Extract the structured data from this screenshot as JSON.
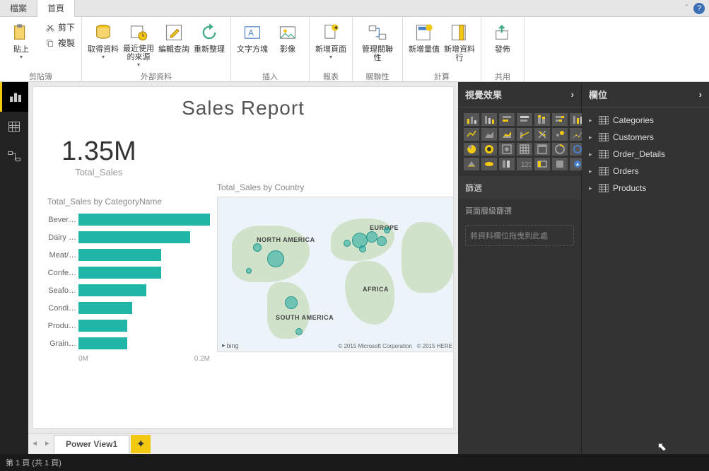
{
  "tabs": {
    "file": "檔案",
    "home": "首頁"
  },
  "ribbon": {
    "clipboard": {
      "paste": "貼上",
      "cut": "剪下",
      "copy": "複製",
      "group": "剪貼簿"
    },
    "external": {
      "getdata": "取得資料",
      "recent": "最近使用的來源",
      "edit": "編輯查詢",
      "refresh": "重新整理",
      "group": "外部資料"
    },
    "insert": {
      "textbox": "文字方塊",
      "image": "影像",
      "group": "插入"
    },
    "report": {
      "newpage": "新增頁面",
      "group": "報表"
    },
    "relation": {
      "manage": "管理關聯性",
      "group": "關聯性"
    },
    "calc": {
      "newmeasure": "新增量值",
      "newtable": "新增資料行",
      "group": "計算"
    },
    "share": {
      "publish": "發佈",
      "group": "共用"
    }
  },
  "report": {
    "title": "Sales Report",
    "kpi_value": "1.35M",
    "kpi_label": "Total_Sales",
    "bar_title": "Total_Sales by CategoryName",
    "map_title": "Total_Sales by Country",
    "map_labels": {
      "na": "NORTH AMERICA",
      "sa": "SOUTH AMERICA",
      "eu": "EUROPE",
      "af": "AFRICA"
    },
    "map_attrib1": "bing",
    "map_attrib2": "© 2015 Microsoft Corporation",
    "map_attrib3": "© 2015 HERE",
    "xaxis": {
      "a": "0M",
      "b": "0.2M"
    }
  },
  "chart_data": {
    "type": "bar",
    "title": "Total_Sales by CategoryName",
    "xlabel": "",
    "ylabel": "",
    "xlim": [
      0,
      0.25
    ],
    "unit": "M",
    "categories": [
      "Bever…",
      "Dairy …",
      "Meat/…",
      "Confe…",
      "Seafo…",
      "Condi…",
      "Produ…",
      "Grain…"
    ],
    "values": [
      0.27,
      0.23,
      0.17,
      0.17,
      0.14,
      0.11,
      0.1,
      0.1
    ]
  },
  "panes": {
    "viz": "視覺效果",
    "fields": "欄位",
    "filter": "篩選",
    "filter_sub": "頁面層級篩選",
    "filter_drop": "將資料欄位拖曳到此處"
  },
  "tables": [
    "Categories",
    "Customers",
    "Order_Details",
    "Orders",
    "Products"
  ],
  "pagetab": {
    "name": "Power View1"
  },
  "footer": "第 1 頁 (共 1 頁)"
}
